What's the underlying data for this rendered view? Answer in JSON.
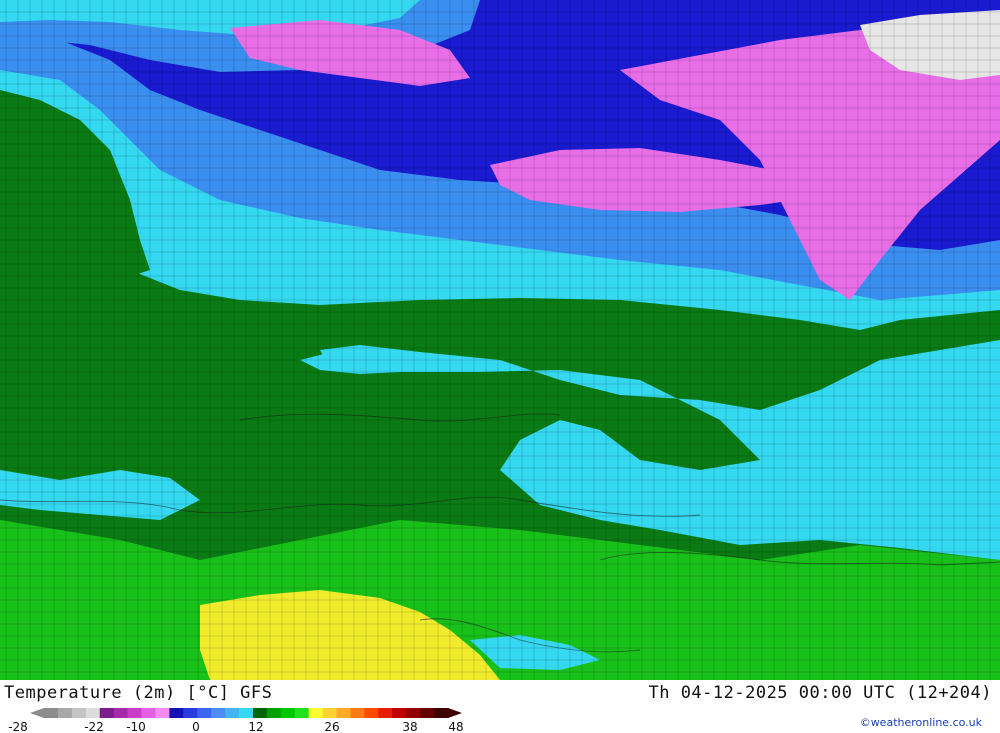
{
  "header": {
    "title": "Temperature (2m) [°C] GFS",
    "run_info": "Th 04-12-2025 00:00 UTC (12+204)",
    "credit": "©weatheronline.co.uk"
  },
  "legend": {
    "tick_labels": [
      "-28",
      "-22",
      "-10",
      "0",
      "12",
      "26",
      "38",
      "48"
    ],
    "colors": [
      "#8c8c8c",
      "#a8a8a8",
      "#c4c4c4",
      "#dcdcdc",
      "#7a1f8a",
      "#a32aa8",
      "#c83ec8",
      "#e260e2",
      "#f48cf4",
      "#1414b4",
      "#2a3ce0",
      "#3c64f0",
      "#4c8cf4",
      "#44b4f4",
      "#38d8f4",
      "#006400",
      "#00a000",
      "#00c800",
      "#22e01e",
      "#ffff32",
      "#ffd232",
      "#ffaa28",
      "#ff7a14",
      "#ff4800",
      "#e61e00",
      "#c00000",
      "#900000",
      "#640000",
      "#3c0000"
    ]
  },
  "map": {
    "value_field_note_colors": {
      "vcold": "#e86ee8",
      "cold": "#1a1ad0",
      "cool": "#3a8ef0",
      "chill": "#34d8f0",
      "mild": "#0a7a14",
      "warm": "#18c01a",
      "hot": "#f0ec2c"
    }
  }
}
